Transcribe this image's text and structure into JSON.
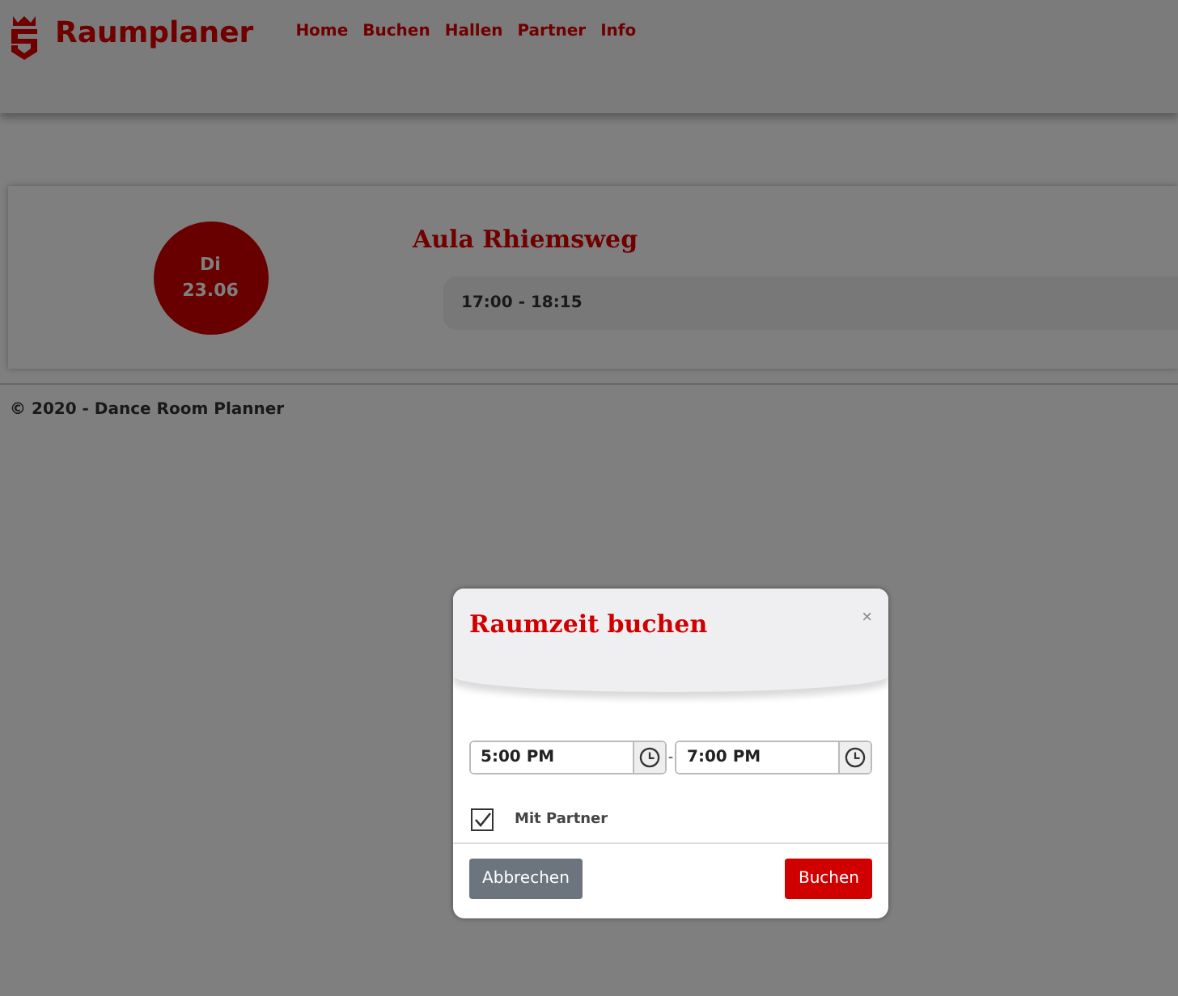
{
  "header": {
    "brand": "Raumplaner",
    "nav": [
      "Home",
      "Buchen",
      "Hallen",
      "Partner",
      "Info"
    ]
  },
  "booking": {
    "day": "Di",
    "date": "23.06",
    "hall": "Aula Rhiemsweg",
    "slots": [
      "17:00 - 18:15"
    ]
  },
  "footer": "© 2020 - Dance Room Planner",
  "dialog": {
    "title": "Raumzeit buchen",
    "close": "×",
    "start_time": "5:00 PM",
    "separator": "-",
    "end_time": "7:00 PM",
    "partner": {
      "label": "Mit Partner",
      "checked": true
    },
    "buttons": {
      "cancel": "Abbrechen",
      "confirm": "Buchen"
    }
  }
}
